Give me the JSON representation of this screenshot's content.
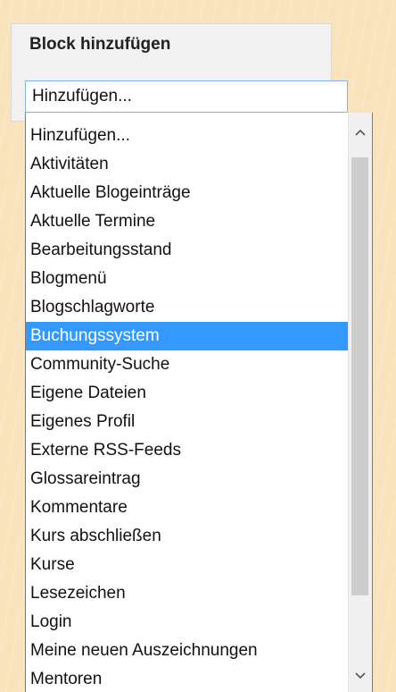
{
  "panel": {
    "title": "Block hinzufügen"
  },
  "select": {
    "current_value": "Hinzufügen..."
  },
  "dropdown": {
    "options": [
      "Hinzufügen...",
      "Aktivitäten",
      "Aktuelle Blogeinträge",
      "Aktuelle Termine",
      "Bearbeitungsstand",
      "Blogmenü",
      "Blogschlagworte",
      "Buchungssystem",
      "Community-Suche",
      "Eigene Dateien",
      "Eigenes Profil",
      "Externe RSS-Feeds",
      "Glossareintrag",
      "Kommentare",
      "Kurs abschließen",
      "Kurse",
      "Lesezeichen",
      "Login",
      "Meine neuen Auszeichnungen",
      "Mentoren"
    ],
    "highlighted": "Buchungssystem"
  },
  "scrollbar": {
    "up_icon": "chevron-up-icon",
    "down_icon": "chevron-down-icon"
  },
  "colors": {
    "background": "#f8e3bc",
    "selection": "#3399ff",
    "focus_border": "#7eb4ea"
  }
}
